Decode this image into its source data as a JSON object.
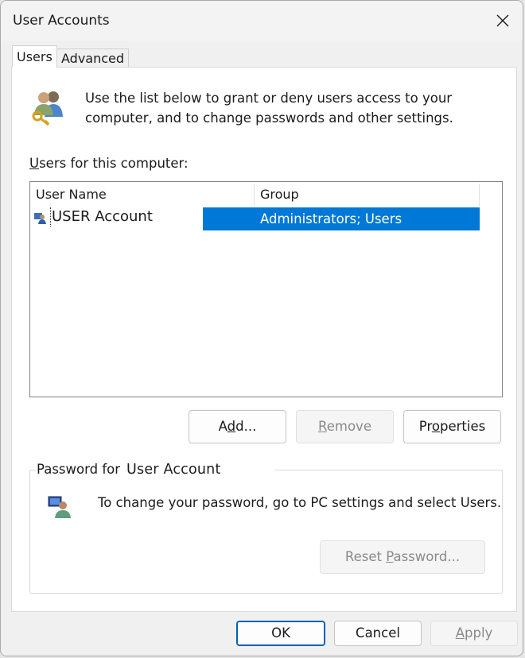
{
  "window": {
    "title": "User Accounts",
    "close_glyph": "✕"
  },
  "tabs": [
    {
      "label": "Users",
      "selected": true
    },
    {
      "label": "Advanced",
      "selected": false
    }
  ],
  "intro": {
    "icon": "users-key-icon",
    "text": "Use the list below to grant or deny users access to your computer, and to change passwords and other settings."
  },
  "users_list": {
    "label_accel": "U",
    "label_rest": "sers for this computer:",
    "columns": [
      "User Name",
      "Group"
    ],
    "rows": [
      {
        "icon": "user-icon",
        "user_name": "USER Account",
        "group": "Administrators; Users",
        "selected": true
      }
    ]
  },
  "buttons": {
    "add": {
      "pre": "A",
      "accel": "d",
      "post": "d..."
    },
    "remove": {
      "pre": "",
      "accel": "R",
      "post": "emove"
    },
    "properties": {
      "pre": "Pr",
      "accel": "o",
      "post": "perties"
    }
  },
  "password": {
    "legend": "Password for",
    "user_name": "User Account",
    "icon": "user-monitor-icon",
    "text": "To change your password, go to PC settings and select Users.",
    "reset": {
      "pre": "Reset ",
      "accel": "P",
      "post": "assword..."
    }
  },
  "footer": {
    "ok": "OK",
    "cancel": "Cancel",
    "apply": {
      "accel": "A",
      "post": "pply"
    }
  },
  "colors": {
    "selection": "#0078d7",
    "default_button_border": "#005fb8"
  }
}
